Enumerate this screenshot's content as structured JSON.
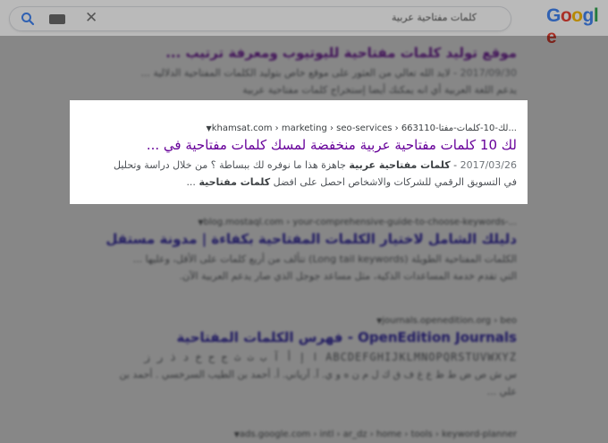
{
  "logo": {
    "letters": [
      "G",
      "o",
      "o",
      "g",
      "l",
      "e"
    ],
    "colors": [
      "#4285f4",
      "#ea4335",
      "#fbbc05",
      "#4285f4",
      "#34a853",
      "#ea4335"
    ]
  },
  "search": {
    "query": "كلمات مفتاحية عربية"
  },
  "results": [
    {
      "breadcrumb": "",
      "title": "موقع توليد كلمات مفتاحية لليوتيوب ومعرفة ترتيب ...",
      "date": "2017/09/30",
      "snippet_1": " - لايد الله تعالي من العثور على موقع خاص بتوليد الكلمات المفتاحية الدلالية ...",
      "snippet_2": "يدعم اللغة العربية أي انه يمكنك أيضا إستخراج كلمات مفتاحية عربية"
    },
    {
      "breadcrumb": "khamsat.com › marketing › seo-services › 663110-لك-10-كلمات-مفتا...",
      "title": "لك 10 كلمات مفتاحية عربية منخفضة لمسك كلمات مفتاحية في ...",
      "date": "2017/03/26",
      "snippet_bold_1": "كلمات مفتاحية عربية",
      "snippet_1": " جاهزة هذا ما نوفره لك ببساطة ؟ من خلال دراسة وتحليل",
      "snippet_2a": "في التسويق الرقمي للشركات والاشخاص احصل على افضل ",
      "snippet_bold_2": "كلمات مفتاحية",
      "snippet_2b": " ..."
    },
    {
      "breadcrumb": "blog.mostaql.com › your-comprehensive-guide-to-choose-keywords-...",
      "title": "دليلك الشامل لاختيار الكلمات المفتاحية بكفاءة | مدونة مستقل",
      "snippet_1": "الكلمات المفتاحية الطويلة (Long tail keywords) تتألف من أربع كلمات على الأقل، وعليها ...",
      "snippet_2": "التي تقدم خدمة المساعدات الذكية، مثل مساعد جوجل الذي صار يدعم العربية الآن."
    },
    {
      "breadcrumb": "journals.openedition.org › beo",
      "title": "OpenEdition Journals - فهرس الكلمات المفتاحية",
      "snippet_1": "ABCDEFGHIJKLMNOPQRSTUVWXYZ ا إ أ آ ب ت ث ج ح خ د ذ ر ز",
      "snippet_2": "س ش ص ض ط ظ ع غ ف ق ك ل م ن ه و ي. آ. آرياني. أ. أحمد بن الطيب السرخسي . أحمد بن",
      "snippet_3": "علي ..."
    },
    {
      "breadcrumb": "ads.google.com › intl › ar_dz › home › tools › keyword-planner"
    }
  ]
}
